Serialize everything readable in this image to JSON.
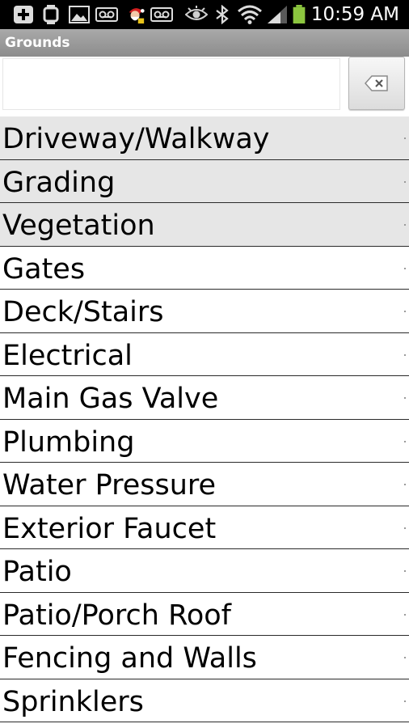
{
  "status_bar": {
    "time": "10:59 AM",
    "icons": [
      "plus-icon",
      "watch-icon",
      "image-icon",
      "voicemail-icon",
      "santa-icon",
      "voicemail-icon",
      "eye-icon",
      "bluetooth-icon",
      "wifi-icon",
      "signal-icon",
      "battery-icon"
    ],
    "battery_color": "#8cc63f"
  },
  "header": {
    "title": "Grounds"
  },
  "search": {
    "value": "",
    "placeholder": ""
  },
  "list": {
    "items": [
      {
        "label": "Driveway/Walkway",
        "shaded": true
      },
      {
        "label": "Grading",
        "shaded": true
      },
      {
        "label": "Vegetation",
        "shaded": true
      },
      {
        "label": "Gates",
        "shaded": false
      },
      {
        "label": "Deck/Stairs",
        "shaded": false
      },
      {
        "label": "Electrical",
        "shaded": false
      },
      {
        "label": "Main Gas Valve",
        "shaded": false
      },
      {
        "label": "Plumbing",
        "shaded": false
      },
      {
        "label": "Water Pressure",
        "shaded": false
      },
      {
        "label": "Exterior Faucet",
        "shaded": false
      },
      {
        "label": "Patio",
        "shaded": false
      },
      {
        "label": "Patio/Porch Roof",
        "shaded": false
      },
      {
        "label": "Fencing and Walls",
        "shaded": false
      },
      {
        "label": "Sprinklers",
        "shaded": false
      }
    ]
  }
}
